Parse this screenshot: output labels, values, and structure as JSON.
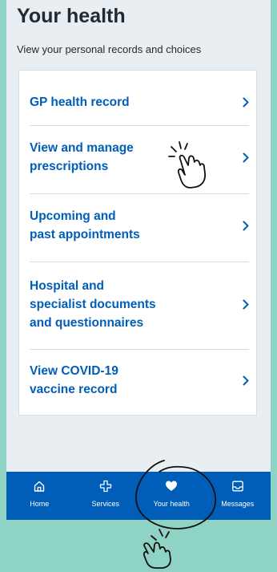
{
  "header": {
    "title": "Your health",
    "subtitle": "View your personal records and choices"
  },
  "menu": {
    "items": [
      {
        "label": "GP health record",
        "icon": "chevron-right-icon"
      },
      {
        "label": "View and manage prescriptions",
        "icon": "chevron-right-icon"
      },
      {
        "label": "Upcoming and past appointments",
        "icon": "chevron-right-icon"
      },
      {
        "label": "Hospital and specialist documents and questionnaires",
        "icon": "chevron-right-icon"
      },
      {
        "label": "View COVID-19 vaccine record",
        "icon": "chevron-right-icon"
      }
    ]
  },
  "tabbar": {
    "tabs": [
      {
        "label": "Home",
        "icon": "home-icon",
        "active": false
      },
      {
        "label": "Services",
        "icon": "services-cross-icon",
        "active": false
      },
      {
        "label": "Your health",
        "icon": "heart-icon",
        "active": true
      },
      {
        "label": "Messages",
        "icon": "inbox-icon",
        "active": false
      }
    ]
  },
  "colors": {
    "brand_blue": "#005eb8",
    "text_dark": "#212b32",
    "page_bg": "#e9eef2",
    "outer_bg": "#8fd3c4",
    "divider": "#d8dde0"
  }
}
